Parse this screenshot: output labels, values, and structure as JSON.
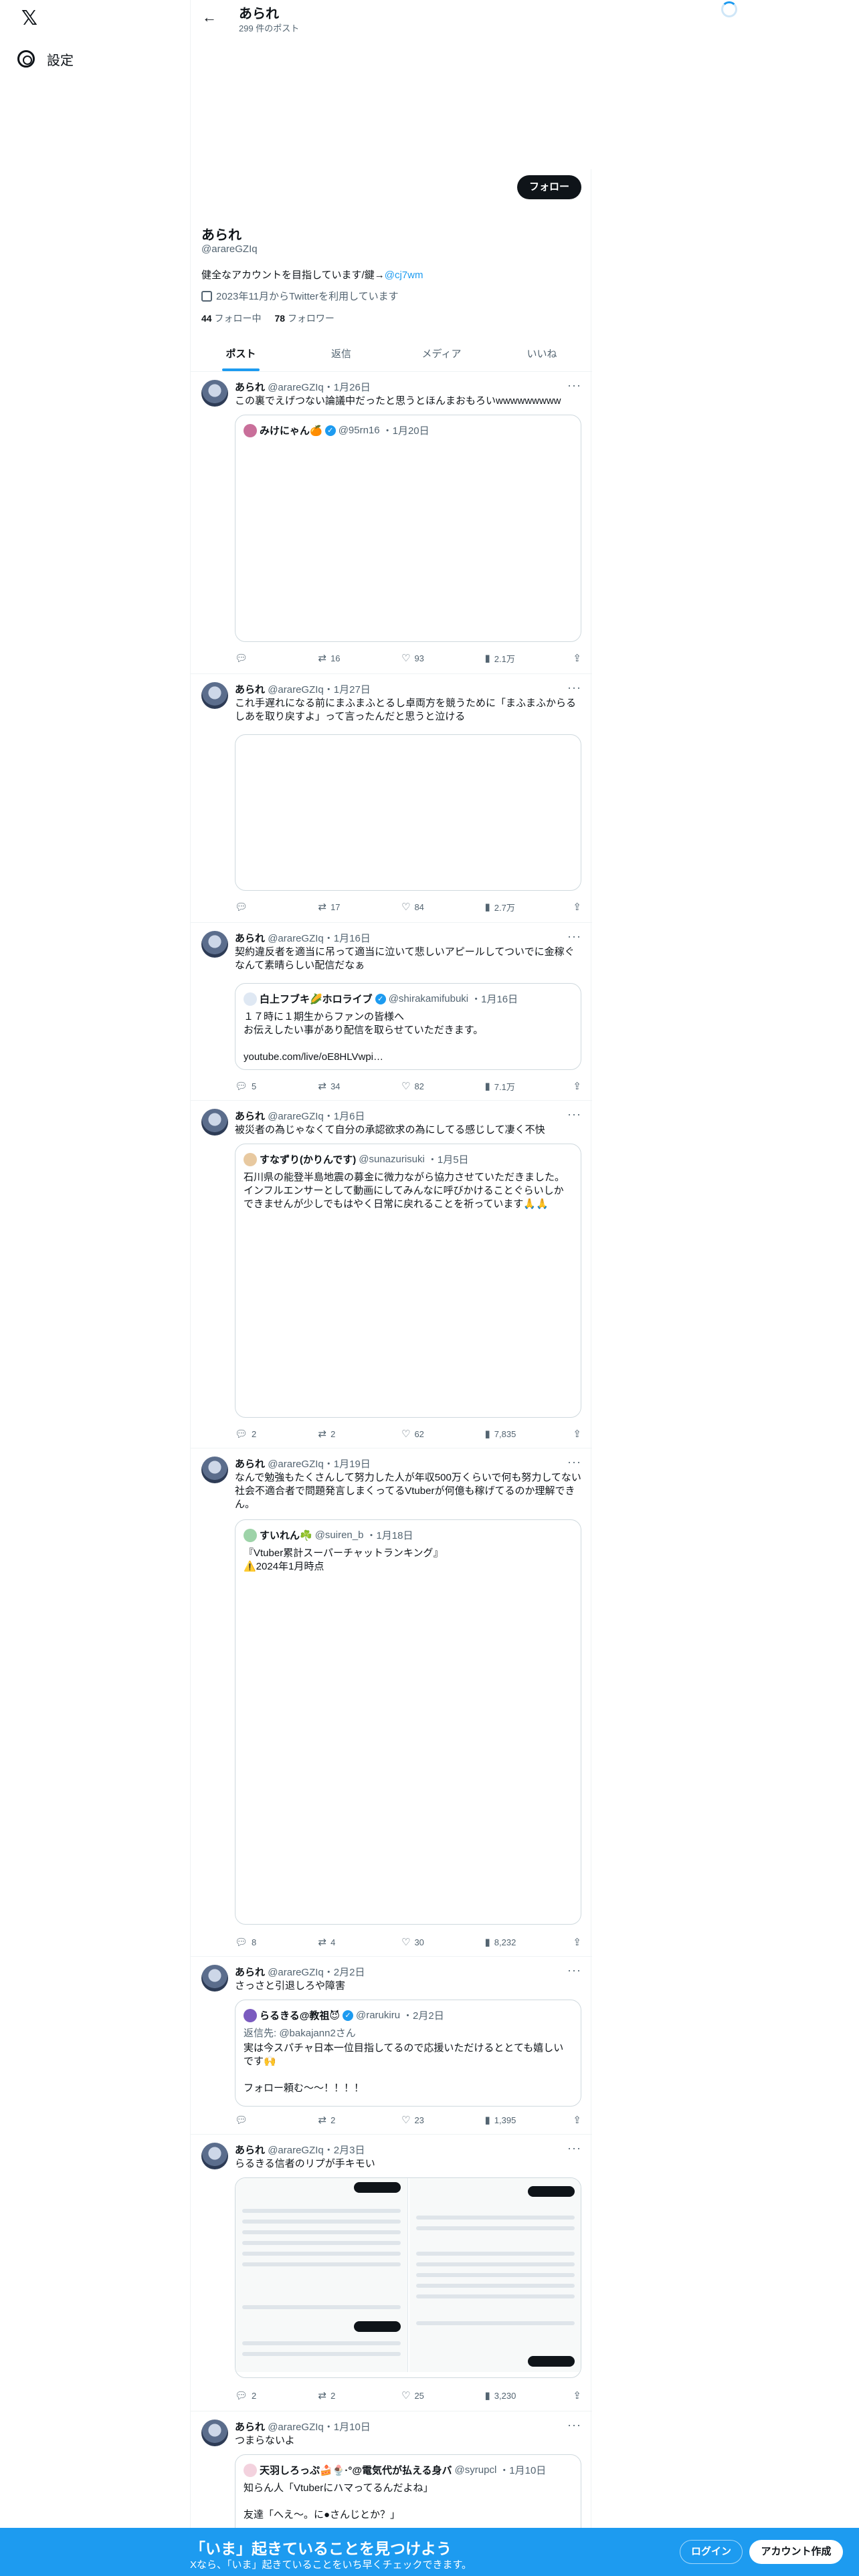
{
  "nav": {
    "logo": "𝕏",
    "settings": "設定"
  },
  "header": {
    "name": "あられ",
    "posts": "299 件のポスト"
  },
  "profile": {
    "name": "あられ",
    "handle": "@arareGZIq",
    "follow": "フォロー",
    "bio": "健全なアカウントを目指しています/鍵→",
    "bio_link": "@cj7wm",
    "joined": "2023年11月からTwitterを利用しています",
    "following_count": "44",
    "following_label": "フォロー中",
    "followers_count": "78",
    "followers_label": "フォロワー"
  },
  "tabs": [
    "ポスト",
    "返信",
    "メディア",
    "いいね"
  ],
  "tweets": [
    {
      "name": "あられ",
      "handle": "@arareGZIq",
      "date": "・1月26日",
      "text": "この裏でえげつない論議中だったと思うとほんまおもろいwwwwwwwww",
      "quote": {
        "name": "みけにゃん🍊",
        "handle": "@95rn16",
        "date": "・1月20日",
        "text": ""
      },
      "reply": "",
      "retweet": "16",
      "like": "93",
      "views": "2.1万"
    },
    {
      "name": "あられ",
      "handle": "@arareGZIq",
      "date": "・1月27日",
      "text": "これ手遅れになる前にまふまふとるし卓両方を競うために「まふまふからるしあを取り戻すよ」って言ったんだと思うと泣ける",
      "reply": "",
      "retweet": "17",
      "like": "84",
      "views": "2.7万"
    },
    {
      "name": "あられ",
      "handle": "@arareGZIq",
      "date": "・1月16日",
      "text": "契約違反者を適当に吊って適当に泣いて悲しいアピールしてついでに金稼ぐなんて素晴らしい配信だなぁ",
      "quote": {
        "name": "白上フブキ🌽ホロライブ",
        "handle": "@shirakamifubuki",
        "date": "・1月16日",
        "text": "１７時に１期生からファンの皆様へ\nお伝えしたい事があり配信を取らせていただきます。\n\nyoutube.com/live/oE8HLVwpi…"
      },
      "reply": "5",
      "retweet": "34",
      "like": "82",
      "views": "7.1万"
    },
    {
      "name": "あられ",
      "handle": "@arareGZIq",
      "date": "・1月6日",
      "text": "被災者の為じゃなくて自分の承認欲求の為にしてる感じして凄く不快",
      "quote": {
        "name": "すなずり(かりんです)",
        "handle": "@sunazurisuki",
        "date": "・1月5日",
        "text": "石川県の能登半島地震の募金に微力ながら協力させていただきました。\nインフルエンサーとして動画にしてみんなに呼びかけることぐらいしかできませんが少しでもはやく日常に戻れることを祈っています🙏🙏"
      },
      "reply": "2",
      "retweet": "2",
      "like": "62",
      "views": "7,835"
    },
    {
      "name": "あられ",
      "handle": "@arareGZIq",
      "date": "・1月19日",
      "text": "なんで勉強もたくさんして努力した人が年収500万くらいで何も努力してない社会不適合者で問題発言しまくってるVtuberが何億も稼げてるのか理解できん。",
      "quote": {
        "name": "すいれん☘️",
        "handle": "@suiren_b",
        "date": "・1月18日",
        "text": "『Vtuber累計スーパーチャットランキング』\n⚠️2024年1月時点"
      },
      "reply": "8",
      "retweet": "4",
      "like": "30",
      "views": "8,232"
    },
    {
      "name": "あられ",
      "handle": "@arareGZIq",
      "date": "・2月2日",
      "text": "さっさと引退しろや障害",
      "quote": {
        "name": "らるきる@教祖😈",
        "handle": "@rarukiru",
        "date": "・2月2日",
        "reply_to": "返信先: @bakajann2さん",
        "text": "実は今スパチャ日本一位目指してるので応援いただけるととても嬉しいです🙌\n\nフォロー頼む〜〜！！！！"
      },
      "reply": "",
      "retweet": "2",
      "like": "23",
      "views": "1,395"
    },
    {
      "name": "あられ",
      "handle": "@arareGZIq",
      "date": "・2月3日",
      "text": "らるきる信者のリプが手キモい",
      "reply": "2",
      "retweet": "2",
      "like": "25",
      "views": "3,230"
    },
    {
      "name": "あられ",
      "handle": "@arareGZIq",
      "date": "・1月10日",
      "text": "つまらないよ",
      "quote": {
        "name": "天羽しろっぷ🍰🍨·°@電気代が払える身バ",
        "handle": "@syrupcl",
        "date": "・1月10日",
        "text": "知らん人「Vtuberにハマってるんだよね」\n\n友達「へえ〜。に●さんじとか？」"
      },
      "reply": "",
      "retweet": "",
      "like": "",
      "views": ""
    }
  ],
  "bottom": {
    "title": "「いま」起きていることを見つけよう",
    "sub": "Xなら、「いま」起きていることをいち早くチェックできます。",
    "login": "ログイン",
    "signup": "アカウント作成"
  }
}
